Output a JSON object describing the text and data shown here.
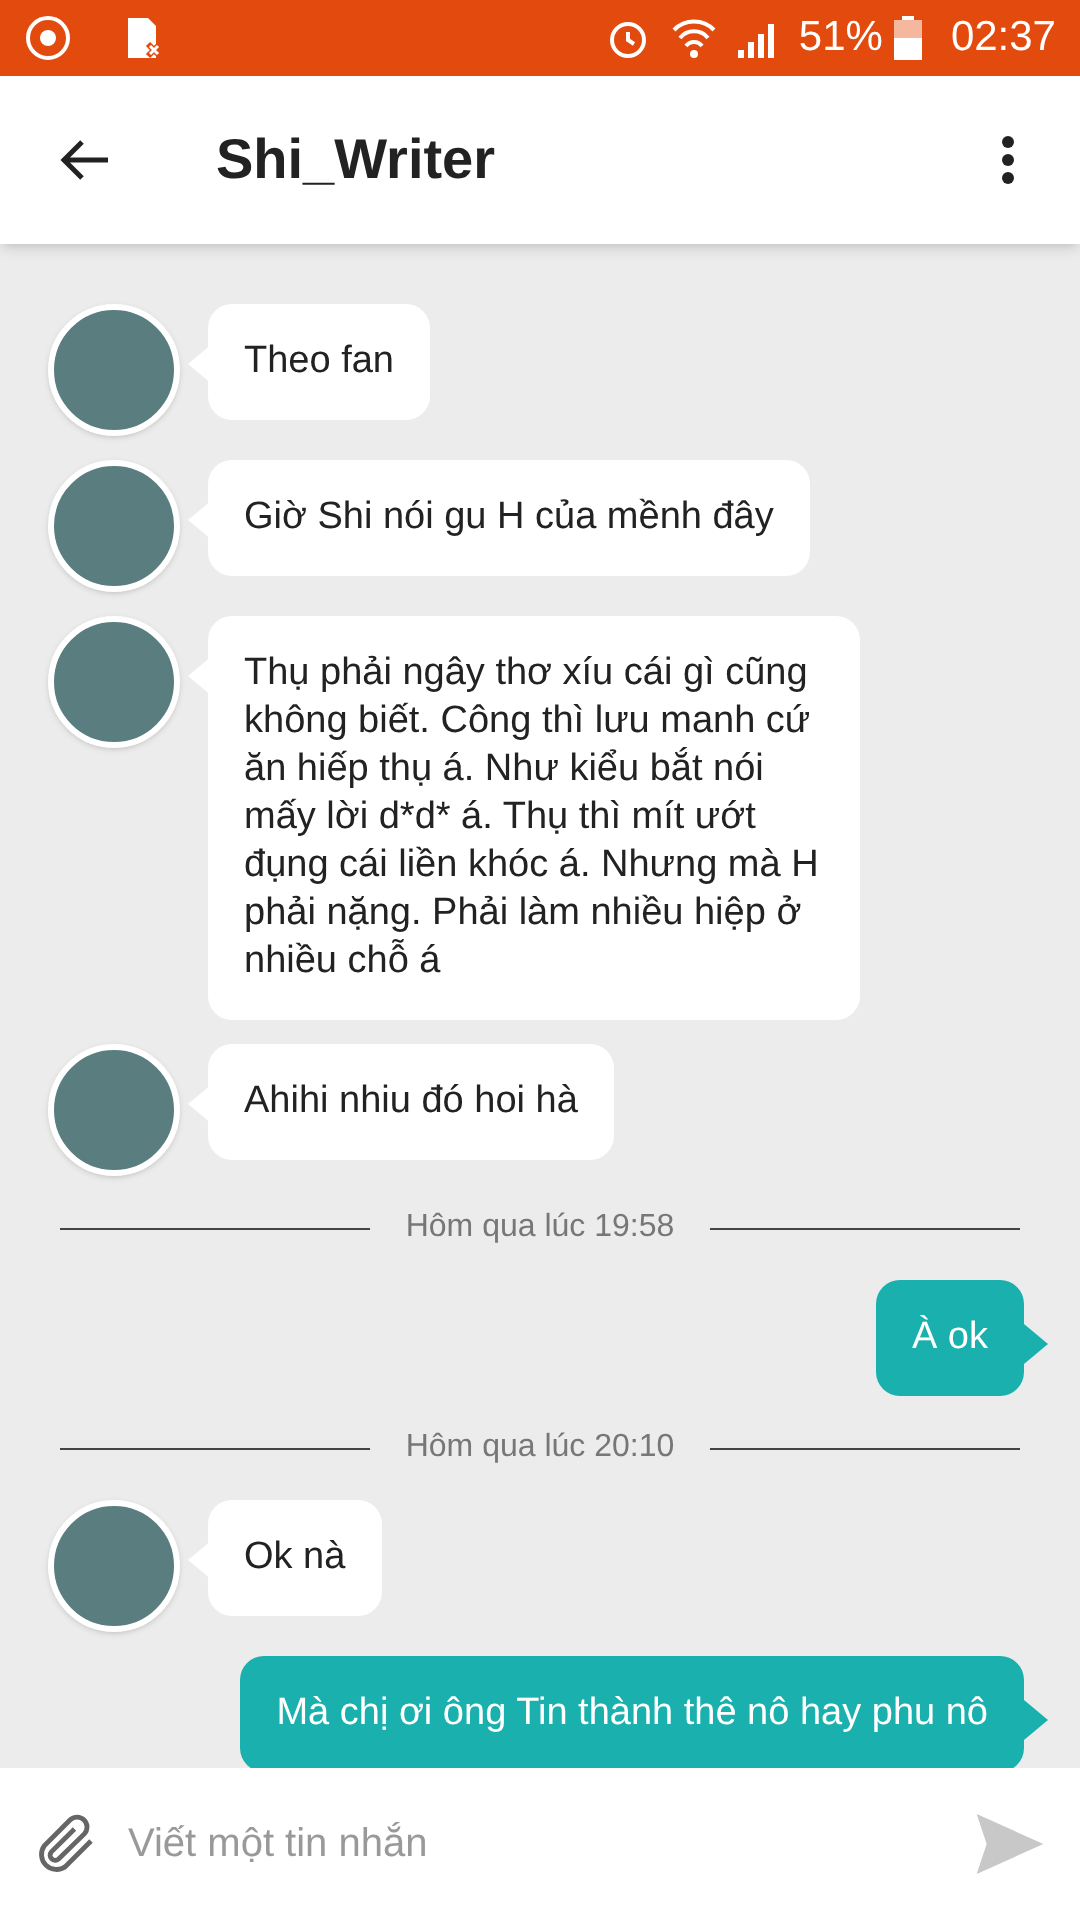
{
  "status_bar": {
    "battery": "51%",
    "time": "02:37"
  },
  "header": {
    "title": "Shi_Writer"
  },
  "messages": [
    {
      "kind": "incoming",
      "text": "Theo fan"
    },
    {
      "kind": "incoming",
      "text": "Giờ Shi nói gu H của mềnh đây"
    },
    {
      "kind": "incoming",
      "text": "Thụ phải ngây thơ xíu cái gì cũng không biết. Công thì lưu manh cứ ăn hiếp thụ á. Như kiểu bắt nói mấy lời d*d* á. Thụ thì mít ướt đụng cái liền khóc á. Nhưng mà H phải nặng. Phải làm nhiều hiệp ở nhiều chỗ á"
    },
    {
      "kind": "incoming",
      "text": "Ahihi nhiu đó hoi hà"
    },
    {
      "kind": "time",
      "text": "Hôm qua lúc 19:58"
    },
    {
      "kind": "outgoing",
      "text": "À ok"
    },
    {
      "kind": "time",
      "text": "Hôm qua lúc 20:10"
    },
    {
      "kind": "incoming",
      "text": "Ok nà"
    },
    {
      "kind": "outgoing",
      "text": "Mà chị ơi ông Tin thành thê nô hay phu nô"
    }
  ],
  "composer": {
    "placeholder": "Viết một tin nhắn"
  }
}
